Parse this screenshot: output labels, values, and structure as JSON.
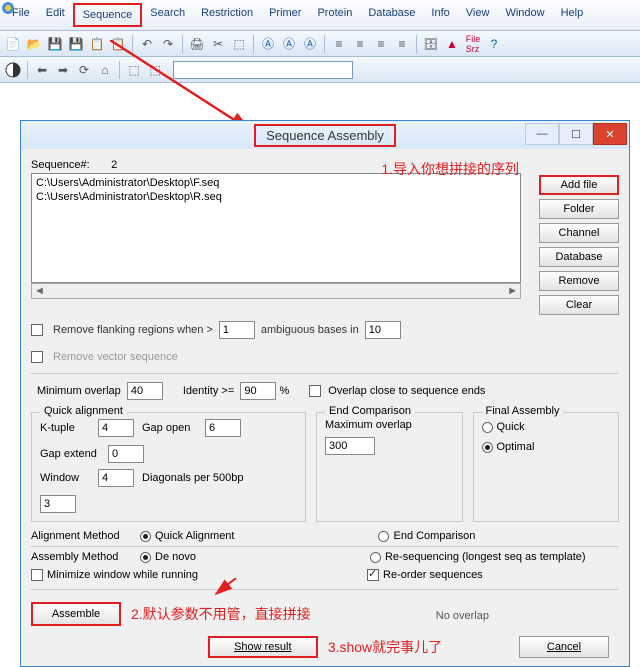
{
  "menubar": {
    "items": [
      "File",
      "Edit",
      "Sequence",
      "Search",
      "Restriction",
      "Primer",
      "Protein",
      "Database",
      "Info",
      "View",
      "Window",
      "Help"
    ],
    "highlight_index": 2
  },
  "dialog": {
    "title": "Sequence Assembly",
    "seq_count_label": "Sequence#:",
    "seq_count": "2",
    "files": [
      "C:\\Users\\Administrator\\Desktop\\F.seq",
      "C:\\Users\\Administrator\\Desktop\\R.seq"
    ],
    "buttons": {
      "add": "Add file",
      "folder": "Folder",
      "channel": "Channel",
      "database": "Database",
      "remove": "Remove",
      "clear": "Clear"
    },
    "flank": {
      "label": "Remove flanking regions when >",
      "val": "1",
      "amb_label": "ambiguous bases in",
      "amb_val": "10"
    },
    "vector": "Remove vector sequence",
    "min_overlap": {
      "label": "Minimum overlap",
      "val": "40"
    },
    "identity": {
      "label": "Identity >=",
      "val": "90",
      "pct": "%"
    },
    "overlap_close": "Overlap close to sequence ends",
    "quick": {
      "label": "Quick alignment",
      "ktuple_l": "K-tuple",
      "ktuple": "4",
      "gapopen_l": "Gap open",
      "gapopen": "6",
      "gapext_l": "Gap extend",
      "gapext": "0",
      "window_l": "Window",
      "window": "4",
      "diag_l": "Diagonals per 500bp",
      "diag": "3"
    },
    "endcomp": {
      "label": "End Comparison",
      "max_l": "Maximum overlap",
      "max": "300"
    },
    "final": {
      "label": "Final Assembly",
      "quick": "Quick",
      "optimal": "Optimal"
    },
    "align_method": {
      "label": "Alignment Method",
      "quick": "Quick Alignment",
      "end": "End Comparison"
    },
    "asm_method": {
      "label": "Assembly Method",
      "denovo": "De novo",
      "reseq": "Re-sequencing (longest seq as template)"
    },
    "min_window": "Minimize window while running",
    "reorder": "Re-order sequences",
    "assemble": "Assemble",
    "no_overlap": "No overlap",
    "show": "Show result",
    "cancel": "Cancel"
  },
  "annotations": {
    "a1": "1.导入你想拼接的序列",
    "a2": "2.默认参数不用管，直接拼接",
    "a3": "3.show就完事儿了"
  }
}
